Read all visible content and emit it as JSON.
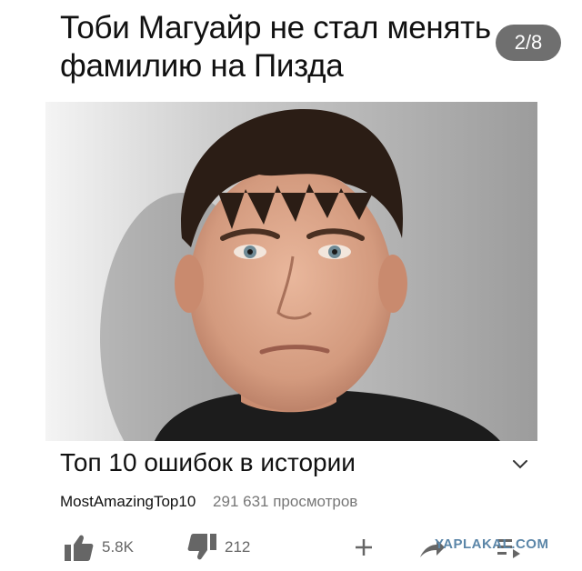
{
  "header": {
    "caption": "Тоби Магуайр не стал менять фамилию на Пизда",
    "page_counter": "2/8"
  },
  "video": {
    "title": "Топ 10 ошибок в истории",
    "channel": "MostAmazingTop10",
    "views": "291 631 просмотров"
  },
  "actions": {
    "like_count": "5.8K",
    "dislike_count": "212"
  },
  "icons": {
    "like": "thumbs-up-icon",
    "dislike": "thumbs-down-icon",
    "add": "plus-icon",
    "share": "share-arrow-icon",
    "save": "save-to-playlist-icon",
    "expand": "chevron-down-icon"
  },
  "watermark": "YAPLAKAL.COM"
}
